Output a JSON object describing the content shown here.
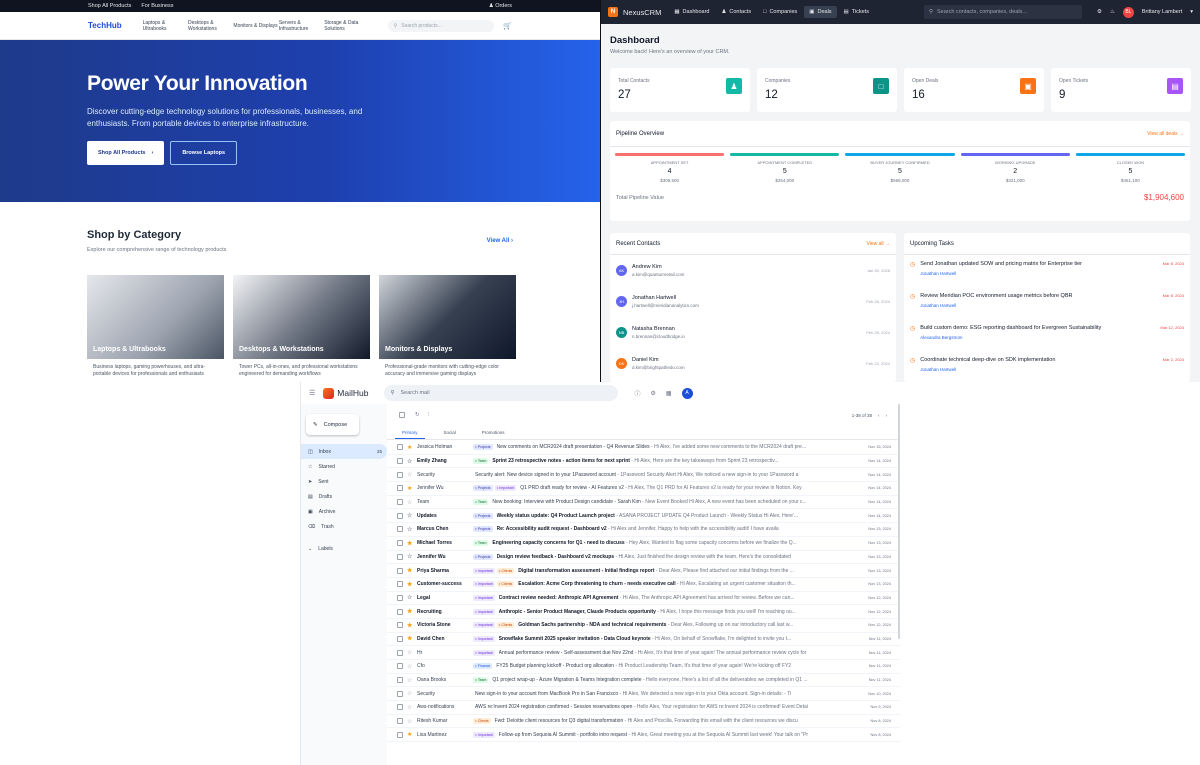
{
  "techhub": {
    "topbar": {
      "shop_all": "Shop All Products",
      "business": "For Business",
      "orders": "Orders"
    },
    "logo": "TechHub",
    "nav": [
      "Laptops & Ultrabooks",
      "Desktops & Workstations",
      "Monitors & Displays",
      "Servers & Infrastructure",
      "Storage & Data Solutions"
    ],
    "search_placeholder": "Search products...",
    "hero": {
      "title": "Power Your Innovation",
      "subtitle": "Discover cutting-edge technology solutions for professionals, businesses, and enthusiasts. From portable devices to enterprise infrastructure.",
      "btn_primary": "Shop All Products",
      "btn_secondary": "Browse Laptops"
    },
    "category": {
      "title": "Shop by Category",
      "subtitle": "Explore our comprehensive range of technology products",
      "view_all": "View All",
      "cards": [
        {
          "name": "Laptops & Ultrabooks",
          "desc": "Business laptops, gaming powerhouses, and ultra-portable devices for professionals and enthusiasts"
        },
        {
          "name": "Desktops & Workstations",
          "desc": "Tower PCs, all-in-ones, and professional workstations engineered for demanding workflows"
        },
        {
          "name": "Monitors & Displays",
          "desc": "Professional-grade monitors with cutting-edge color accuracy and immersive gaming displays"
        }
      ]
    }
  },
  "crm": {
    "brand": "NexusCRM",
    "logo_letter": "N",
    "tabs": [
      "Dashboard",
      "Contacts",
      "Companies",
      "Deals",
      "Tickets"
    ],
    "search_placeholder": "Search contacts, companies, deals...",
    "user": "Brittany Lambert",
    "user_initials": "BL",
    "title": "Dashboard",
    "welcome": "Welcome back! Here's an overview of your CRM.",
    "stats": [
      {
        "label": "Total Contacts",
        "value": "27",
        "color": "#14b8a6",
        "icon": "contacts-icon"
      },
      {
        "label": "Companies",
        "value": "12",
        "color": "#0d9488",
        "icon": "building-icon"
      },
      {
        "label": "Open Deals",
        "value": "16",
        "color": "#f97316",
        "icon": "briefcase-icon"
      },
      {
        "label": "Open Tickets",
        "value": "9",
        "color": "#a855f7",
        "icon": "ticket-icon"
      }
    ],
    "pipeline": {
      "title": "Pipeline Overview",
      "view_all": "View all deals →",
      "stages": [
        {
          "name": "APPOINTMENT SET",
          "count": "4",
          "amount": "$309,500",
          "color": "#f87171"
        },
        {
          "name": "APPOINTMENT COMPLETED",
          "count": "5",
          "amount": "$254,000",
          "color": "#14b8a6"
        },
        {
          "name": "BUYER JOURNEY CONFIRMED",
          "count": "5",
          "amount": "$568,000",
          "color": "#0ea5e9"
        },
        {
          "name": "WORKING UPGRADE",
          "count": "2",
          "amount": "$321,000",
          "color": "#6366f1"
        },
        {
          "name": "CLOSED WON",
          "count": "5",
          "amount": "$451,100",
          "color": "#0ea5e9"
        }
      ],
      "total_label": "Total Pipeline Value",
      "total_value": "$1,904,600"
    },
    "recent_contacts": {
      "title": "Recent Contacts",
      "view_all": "View all →",
      "items": [
        {
          "initials": "AK",
          "name": "Andrew Kim",
          "email": "a.kim@quantumretail.com",
          "date": "Jan 30, 2026",
          "color": "#6366f1"
        },
        {
          "initials": "JH",
          "name": "Jonathan Hartwell",
          "email": "j.hartwell@meridiananalytics.com",
          "date": "Feb 28, 2024",
          "color": "#6366f1"
        },
        {
          "initials": "NB",
          "name": "Natasha Brennan",
          "email": "n.brennan@cloudbridge.io",
          "date": "Feb 25, 2024",
          "color": "#0d9488"
        },
        {
          "initials": "DK",
          "name": "Daniel Kim",
          "email": "d.kim@brightpathedu.com",
          "date": "Feb 22, 2024",
          "color": "#f97316"
        }
      ]
    },
    "upcoming_tasks": {
      "title": "Upcoming Tasks",
      "items": [
        {
          "title": "Send Jonathan updated SOW and pricing matrix for Enterprise tier",
          "person": "Jonathan Hartwell",
          "date": "Mar 8, 2024"
        },
        {
          "title": "Review Meridian POC environment usage metrics before QBR",
          "person": "Jonathan Hartwell",
          "date": "Mar 8, 2024"
        },
        {
          "title": "Build custom demo: ESG reporting dashboard for Evergreen Sustainability",
          "person": "Alexandra Bergstrom",
          "date": "Mar 12, 2024"
        },
        {
          "title": "Coordinate technical deep-dive on SDK implementation",
          "person": "Jonathan Hartwell",
          "date": "Mar 2, 2024"
        }
      ]
    }
  },
  "mail": {
    "brand": "MailHub",
    "search_placeholder": "Search mail",
    "user_initial": "A",
    "compose": "Compose",
    "folders": [
      {
        "name": "Inbox",
        "count": "25",
        "icon": "inbox-icon"
      },
      {
        "name": "Starred",
        "count": "",
        "icon": "star-icon"
      },
      {
        "name": "Sent",
        "count": "",
        "icon": "send-icon"
      },
      {
        "name": "Drafts",
        "count": "",
        "icon": "draft-icon"
      },
      {
        "name": "Archive",
        "count": "",
        "icon": "archive-icon"
      },
      {
        "name": "Trash",
        "count": "",
        "icon": "trash-icon"
      }
    ],
    "labels": "Labels",
    "pagination": "1-38 of 38",
    "tabs": [
      "Primary",
      "Social",
      "Promotions"
    ],
    "emails": [
      {
        "sender": "Jessica Holman",
        "starred": true,
        "unread": false,
        "tags": [
          "Projects"
        ],
        "subject": "New comments on MCR2024 draft presentation - Q4 Revenue Slides",
        "preview": " - Hi Alex, I've added some new comments to the MCR2024 draft pre...",
        "date": "Nov 15, 2024"
      },
      {
        "sender": "Emily Zhang",
        "starred": false,
        "unread": true,
        "tags": [
          "Team"
        ],
        "subject": "Sprint 23 retrospective notes - action items for next sprint",
        "preview": " - Hi Alex, Here are the key takeaways from Sprint 23 retrospectiv...",
        "date": "Nov 14, 2024"
      },
      {
        "sender": "Security",
        "starred": false,
        "unread": false,
        "tags": [],
        "subject": "Security alert: New device signed in to your 1Password account",
        "preview": " - 1Password Security Alert Hi Alex, We noticed a new sign-in to your 1Password a",
        "date": "Nov 14, 2024"
      },
      {
        "sender": "Jennifer Wu",
        "starred": true,
        "unread": false,
        "tags": [
          "Projects",
          "Important"
        ],
        "subject": "Q1 PRD draft ready for review - AI Features v2",
        "preview": " - Hi Alex, The Q1 PRD for AI Features v2 is ready for your review in Notion. Key",
        "date": "Nov 14, 2024"
      },
      {
        "sender": "Team",
        "starred": false,
        "unread": false,
        "tags": [
          "Team"
        ],
        "subject": "New booking: Interview with Product Design candidate - Sarah Kim",
        "preview": " - New Event Booked Hi Alex, A new event has been scheduled on your c...",
        "date": "Nov 14, 2024"
      },
      {
        "sender": "Updates",
        "starred": false,
        "unread": true,
        "tags": [
          "Projects"
        ],
        "subject": "Weekly status update: Q4 Product Launch project",
        "preview": " - ASANA PROJECT UPDATE Q4 Product Launch - Weekly Status Hi Alex, Here'...",
        "date": "Nov 14, 2024"
      },
      {
        "sender": "Marcus Chen",
        "starred": false,
        "unread": true,
        "tags": [
          "Projects"
        ],
        "subject": "Re: Accessibility audit request - Dashboard v2",
        "preview": " - Hi Alex and Jennifer, Happy to help with the accessibility audit! I have availa",
        "date": "Nov 13, 2024"
      },
      {
        "sender": "Michael Torres",
        "starred": true,
        "unread": true,
        "tags": [
          "Team"
        ],
        "subject": "Engineering capacity concerns for Q1 - need to discuss",
        "preview": " - Hey Alex, Wanted to flag some capacity concerns before we finalize the Q...",
        "date": "Nov 13, 2024"
      },
      {
        "sender": "Jennifer Wu",
        "starred": false,
        "unread": true,
        "tags": [
          "Projects"
        ],
        "subject": "Design review feedback - Dashboard v2 mockups",
        "preview": " - Hi Alex, Just finished the design review with the team. Here's the consolidated",
        "date": "Nov 13, 2024"
      },
      {
        "sender": "Priya Sharma",
        "starred": true,
        "unread": true,
        "tags": [
          "Important",
          "Clients"
        ],
        "subject": "Digital transformation assessment - Initial findings report",
        "preview": " - Dear Alex, Please find attached our initial findings from the ...",
        "date": "Nov 13, 2024"
      },
      {
        "sender": "Customer-success",
        "starred": true,
        "unread": true,
        "tags": [
          "Important",
          "Clients"
        ],
        "subject": "Escalation: Acme Corp threatening to churn - needs executive call",
        "preview": " - Hi Alex, Escalating an urgent customer situation th...",
        "date": "Nov 13, 2024"
      },
      {
        "sender": "Legal",
        "starred": false,
        "unread": true,
        "tags": [
          "Important"
        ],
        "subject": "Contract review needed: Anthropic API Agreement",
        "preview": " - Hi Alex, The Anthropic API Agreement has arrived for review. Before we can...",
        "date": "Nov 12, 2024"
      },
      {
        "sender": "Recruiting",
        "starred": true,
        "unread": true,
        "tags": [
          "Important"
        ],
        "subject": "Anthropic - Senior Product Manager, Claude Products opportunity",
        "preview": " - Hi Alex, I hope this message finds you well! I'm reaching ou...",
        "date": "Nov 12, 2024"
      },
      {
        "sender": "Victoria Stone",
        "starred": true,
        "unread": true,
        "tags": [
          "Important",
          "Clients"
        ],
        "subject": "Goldman Sachs partnership - NDA and technical requirements",
        "preview": " - Dear Alex, Following up on our introductory call last w...",
        "date": "Nov 12, 2024"
      },
      {
        "sender": "David Chen",
        "starred": true,
        "unread": true,
        "tags": [
          "Important"
        ],
        "subject": "Snowflake Summit 2025 speaker invitation - Data Cloud keynote",
        "preview": " - Hi Alex, On behalf of Snowflake, I'm delighted to invite you t...",
        "date": "Nov 11, 2024"
      },
      {
        "sender": "Hr",
        "starred": false,
        "unread": false,
        "tags": [
          "Important"
        ],
        "subject": "Annual performance review - Self-assessment due Nov 22nd",
        "preview": " - Hi Alex, It's that time of year again! The annual performance review cycle for",
        "date": "Nov 11, 2024"
      },
      {
        "sender": "Cfo",
        "starred": false,
        "unread": false,
        "tags": [
          "Finance"
        ],
        "subject": "FY25 Budget planning kickoff - Product org allocation",
        "preview": " - Hi Product Leadership Team, It's that time of year again! We're kicking off FY2",
        "date": "Nov 11, 2024"
      },
      {
        "sender": "Oana Brooks",
        "starred": false,
        "unread": false,
        "tags": [
          "Team"
        ],
        "subject": "Q1 project wrap-up - Azure Migration & Teams Integration complete",
        "preview": " - Hello everyone, Here's a list of all the deliverables we completed in Q1 ...",
        "date": "Nov 11, 2024"
      },
      {
        "sender": "Security",
        "starred": false,
        "unread": false,
        "tags": [],
        "subject": "New sign-in to your account from MacBook Pro in San Francisco",
        "preview": " - Hi Alex, We detected a new sign-in to your Okta account. Sign-in details: - Ti",
        "date": "Nov 10, 2024"
      },
      {
        "sender": "Aws-notifications",
        "starred": false,
        "unread": false,
        "tags": [],
        "subject": "AWS re:Invent 2024 registration confirmed - Session reservations open",
        "preview": " - Hello Alex, Your registration for AWS re:Invent 2024 is confirmed! Event Detai",
        "date": "Nov 9, 2024"
      },
      {
        "sender": "Ritesh Kumar",
        "starred": false,
        "unread": false,
        "tags": [
          "Clients"
        ],
        "subject": "Fwd: Deloitte client resources for Q3 digital transformation",
        "preview": " - Hi Alex and Priscilla, Forwarding this email with the client resources we discu",
        "date": "Nov 8, 2024"
      },
      {
        "sender": "Lisa Martinez",
        "starred": true,
        "unread": false,
        "tags": [
          "Important"
        ],
        "subject": "Follow-up from Sequoia AI Summit - portfolio intro request",
        "preview": " - Hi Alex, Great meeting you at the Sequoia AI Summit last week! Your talk on \"Pr",
        "date": "Nov 8, 2024"
      }
    ]
  }
}
